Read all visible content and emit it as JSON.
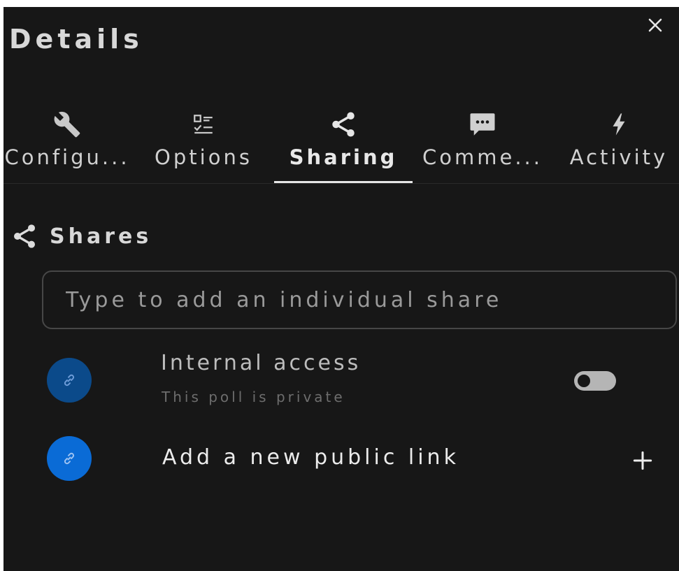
{
  "panel": {
    "title": "Details",
    "close_icon": "close-icon"
  },
  "tabs": [
    {
      "label": "Configu...",
      "icon": "wrench-icon",
      "active": false
    },
    {
      "label": "Options",
      "icon": "checklist-icon",
      "active": false
    },
    {
      "label": "Sharing",
      "icon": "share-icon",
      "active": true
    },
    {
      "label": "Comme...",
      "icon": "comment-icon",
      "active": false
    },
    {
      "label": "Activity",
      "icon": "lightning-icon",
      "active": false
    }
  ],
  "shares": {
    "heading": "Shares",
    "search_placeholder": "Type to add an individual share",
    "internal": {
      "title": "Internal access",
      "subtitle": "This poll is private",
      "toggle_on": false
    },
    "public_link": {
      "label": "Add a new public link"
    }
  },
  "colors": {
    "background": "#171717",
    "avatar_dim": "#0b4a8a",
    "avatar_bright": "#0a6bd6",
    "link_icon": "#7fb0ee"
  }
}
